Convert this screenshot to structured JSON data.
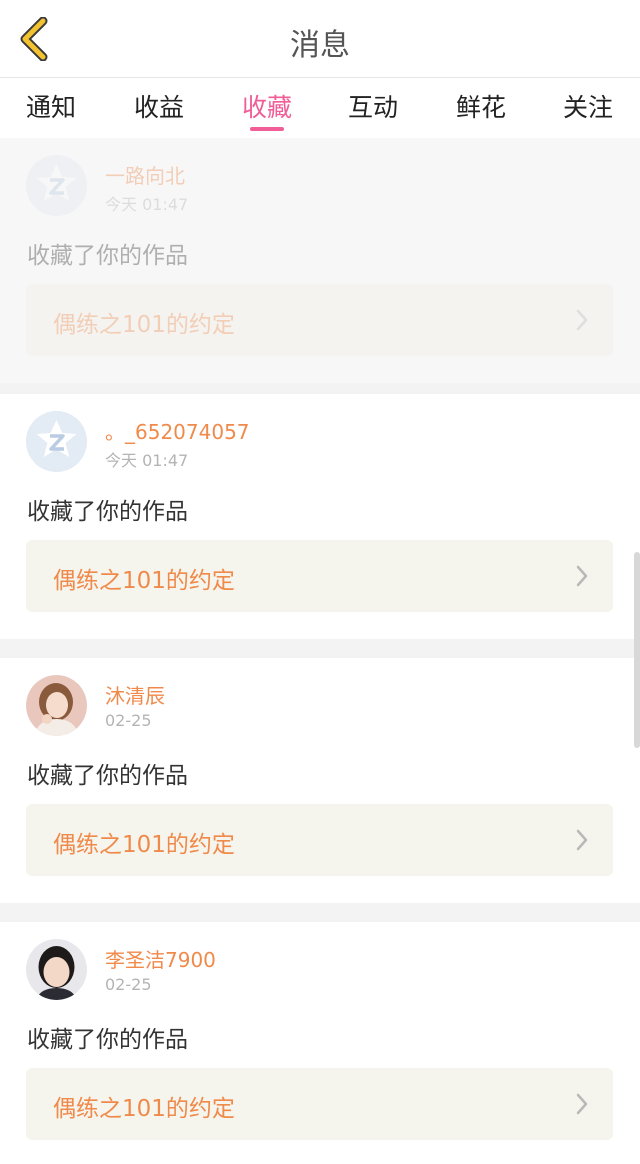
{
  "header": {
    "title": "消息",
    "back_icon": "chevron-left-icon",
    "accent": "#f2c230"
  },
  "tabs": [
    {
      "label": "通知"
    },
    {
      "label": "收益"
    },
    {
      "label": "收藏",
      "active": true
    },
    {
      "label": "互动"
    },
    {
      "label": "鲜花"
    },
    {
      "label": "关注"
    }
  ],
  "colors": {
    "active_tab": "#ef5e96",
    "username": "#f08a4b",
    "work_bg": "#f5f5ed"
  },
  "items": [
    {
      "username": "一路向北",
      "time": "今天 01:47",
      "action": "收藏了你的作品",
      "work_title": "偶练之101的约定",
      "avatar": "default-avatar-icon"
    },
    {
      "username": "。_652074057",
      "time": "今天 01:47",
      "action": "收藏了你的作品",
      "work_title": "偶练之101的约定",
      "avatar": "default-avatar-icon"
    },
    {
      "username": "沐清辰",
      "time": "02-25",
      "action": "收藏了你的作品",
      "work_title": "偶练之101的约定",
      "avatar": "user-photo"
    },
    {
      "username": "李圣洁7900",
      "time": "02-25",
      "action": "收藏了你的作品",
      "work_title": "偶练之101的约定",
      "avatar": "user-photo"
    }
  ]
}
